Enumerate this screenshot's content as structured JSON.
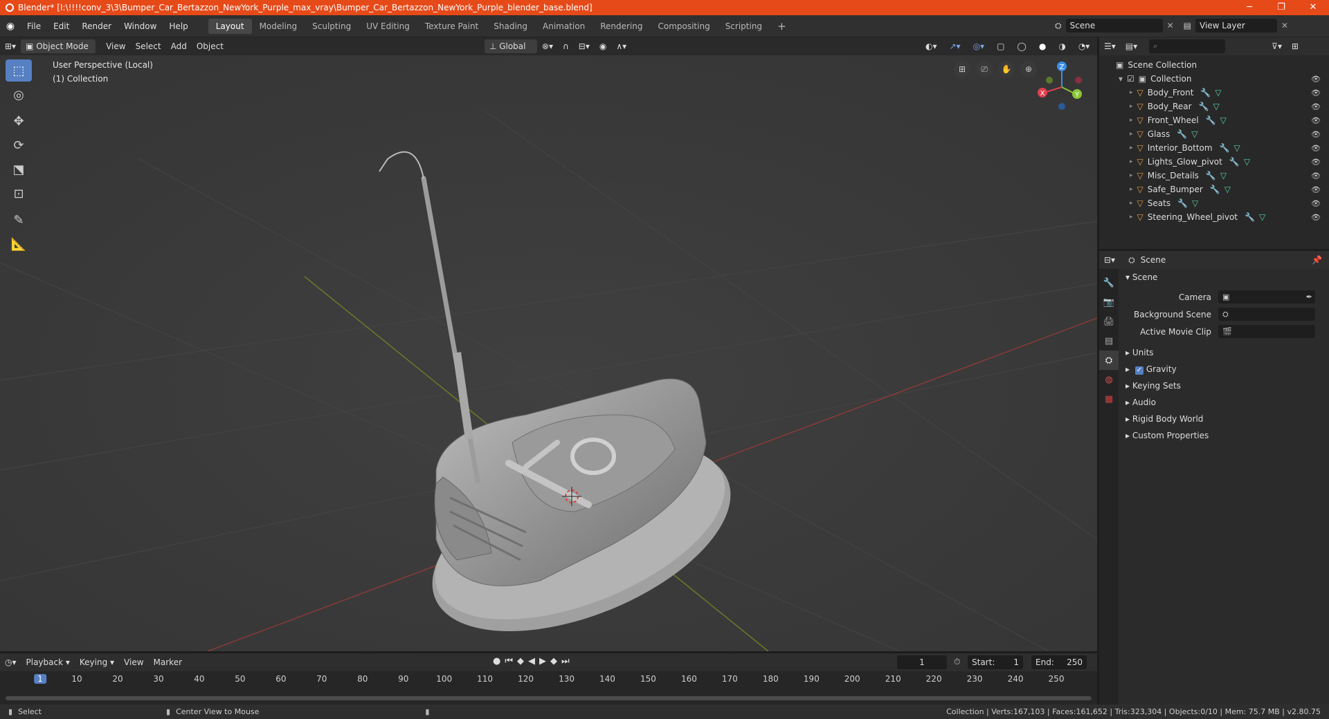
{
  "window": {
    "title": "Blender* [I:\\!!!!conv_3\\3\\Bumper_Car_Bertazzon_NewYork_Purple_max_vray\\Bumper_Car_Bertazzon_NewYork_Purple_blender_base.blend]",
    "controls": [
      "─",
      "❐",
      "✕"
    ]
  },
  "menubar": {
    "items": [
      "File",
      "Edit",
      "Render",
      "Window",
      "Help"
    ]
  },
  "workspaces": {
    "tabs": [
      "Layout",
      "Modeling",
      "Sculpting",
      "UV Editing",
      "Texture Paint",
      "Shading",
      "Animation",
      "Rendering",
      "Compositing",
      "Scripting"
    ],
    "add": "+"
  },
  "scene_selector": {
    "value": "Scene"
  },
  "viewlayer_selector": {
    "value": "View Layer"
  },
  "viewport_header": {
    "mode": "Object Mode",
    "menus": [
      "View",
      "Select",
      "Add",
      "Object"
    ],
    "orientation": "Global"
  },
  "viewport": {
    "perspective": "User Perspective (Local)",
    "collection": "(1) Collection",
    "gizmo_axes": [
      "Z",
      "Y",
      "X"
    ]
  },
  "outliner": {
    "root": "Scene Collection",
    "collection": "Collection",
    "objects": [
      "Body_Front",
      "Body_Rear",
      "Front_Wheel",
      "Glass",
      "Interior_Bottom",
      "Lights_Glow_pivot",
      "Misc_Details",
      "Safe_Bumper",
      "Seats",
      "Steering_Wheel_pivot"
    ]
  },
  "properties": {
    "header": "Scene",
    "section": "Scene",
    "rows": [
      {
        "label": "Camera"
      },
      {
        "label": "Background Scene"
      },
      {
        "label": "Active Movie Clip"
      }
    ],
    "subsections": [
      "Units",
      "Gravity",
      "Keying Sets",
      "Audio",
      "Rigid Body World",
      "Custom Properties"
    ],
    "gravity_checked": true
  },
  "timeline": {
    "menus": [
      "Playback",
      "Keying",
      "View",
      "Marker"
    ],
    "current_frame": "1",
    "start_label": "Start:",
    "start": "1",
    "end_label": "End:",
    "end": "250",
    "ruler": [
      "1",
      "10",
      "20",
      "30",
      "40",
      "50",
      "60",
      "70",
      "80",
      "90",
      "100",
      "110",
      "120",
      "130",
      "140",
      "150",
      "160",
      "170",
      "180",
      "190",
      "200",
      "210",
      "220",
      "230",
      "240",
      "250"
    ]
  },
  "statusbar": {
    "left_action": "Select",
    "mid_action": "Center View to Mouse",
    "stats": "Collection | Verts:167,103 | Faces:161,652 | Tris:323,304 | Objects:0/10 | Mem: 75.7 MB | v2.80.75"
  },
  "colors": {
    "titlebar": "#e64a19",
    "accent": "#5680c2",
    "axis_x": "#e0404f",
    "axis_y": "#8ac735",
    "axis_z": "#3a8ee6"
  }
}
